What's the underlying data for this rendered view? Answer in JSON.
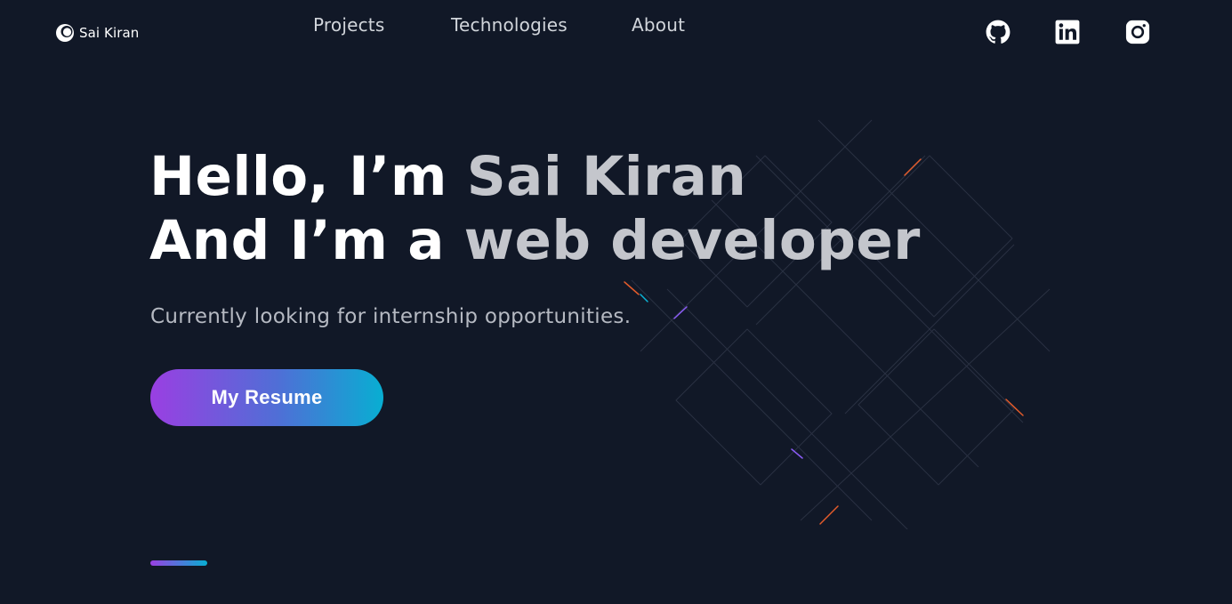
{
  "header": {
    "logo_text": "Sai Kiran",
    "nav": [
      {
        "label": "Projects"
      },
      {
        "label": "Technologies"
      },
      {
        "label": "About"
      }
    ],
    "social": [
      {
        "icon": "github-icon"
      },
      {
        "icon": "linkedin-icon"
      },
      {
        "icon": "instagram-icon"
      }
    ]
  },
  "hero": {
    "line1_plain": "Hello, I’m ",
    "line1_accent": "Sai Kiran",
    "line2_plain": "And I’m a ",
    "line2_accent": "web developer",
    "subtitle": "Currently looking for internship opportunities.",
    "cta_label": "My Resume"
  },
  "colors": {
    "background": "#111827",
    "accent_gradient_start": "#9a3fe2",
    "accent_gradient_end": "#08aed2",
    "heading_white": "#ffffff",
    "heading_accent": "#c4c6cc",
    "subtitle": "#b5b9c2",
    "nav_text": "#d1d5db"
  }
}
